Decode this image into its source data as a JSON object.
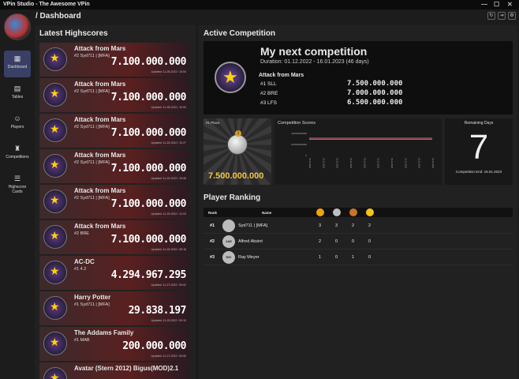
{
  "window": {
    "title": "VPin Studio - The Awesome VPin"
  },
  "header": {
    "breadcrumb": "/ Dashboard"
  },
  "nav": [
    {
      "label": "Dashboard",
      "icon": "grid-icon"
    },
    {
      "label": "Tables",
      "icon": "table-icon"
    },
    {
      "label": "Players",
      "icon": "user-icon"
    },
    {
      "label": "Competitions",
      "icon": "trophy-icon"
    },
    {
      "label": "Highscore Cards",
      "icon": "list-icon"
    }
  ],
  "highscores": {
    "title": "Latest Highscores",
    "items": [
      {
        "table": "Attack from Mars",
        "player": "#2  Syd711 | [MFA]",
        "score": "7.100.000.000",
        "updated": "Updated: 11-28-2022 / 10:54"
      },
      {
        "table": "Attack from Mars",
        "player": "#2  Syd711 | [MFA]",
        "score": "7.100.000.000",
        "updated": "Updated: 11-28-2022 / 10:53"
      },
      {
        "table": "Attack from Mars",
        "player": "#2  Syd711 | [MFA]",
        "score": "7.100.000.000",
        "updated": "Updated: 11-29-2022 / 10:27"
      },
      {
        "table": "Attack from Mars",
        "player": "#2  Syd711 | [MFA]",
        "score": "7.100.000.000",
        "updated": "Updated: 11-29-2022 / 10:08"
      },
      {
        "table": "Attack from Mars",
        "player": "#2  Syd711 | [MFA]",
        "score": "7.100.000.000",
        "updated": "Updated: 11-29-2022 / 12:03"
      },
      {
        "table": "Attack from Mars",
        "player": "#2  BRE",
        "score": "7.100.000.000",
        "updated": "Updated: 11-29-2022 / 08:18"
      },
      {
        "table": "AC-DC",
        "player": "#1  4.2",
        "score": "4.294.967.295",
        "updated": "Updated: 11-27-2022 / 09:02"
      },
      {
        "table": "Harry Potter",
        "player": "#1  Syd711 | [MFA]",
        "score": "29.838.197",
        "updated": "Updated: 11-29-2022 / 09:10"
      },
      {
        "table": "The Addams Family",
        "player": "#1  MAB",
        "score": "200.000.000",
        "updated": "Updated: 11-27-2022 / 09:06"
      },
      {
        "table": "Avatar (Stern 2012)  Bigus(MOD)2.1",
        "player": "",
        "score": "",
        "updated": ""
      }
    ]
  },
  "competition": {
    "section_title": "Active Competition",
    "name": "My next competition",
    "duration": "Duration: 01.12.2022  -  16.01.2023 (46 days)",
    "table": "Attack from Mars",
    "ranks": [
      {
        "pos": "#1",
        "player": "SLL",
        "score": "7.500.000.000"
      },
      {
        "pos": "#2",
        "player": "BRE",
        "score": "7.000.000.000"
      },
      {
        "pos": "#3",
        "player": "LFS",
        "score": "6.500.000.000"
      }
    ],
    "first_place_label": "#1 Place",
    "first_place_value": "7.500.000.000",
    "scores_label": "Competition Scores",
    "remaining_label": "Remaining Days",
    "remaining_value": "7",
    "end_label": "Competition End: 16.01.2023"
  },
  "chart_data": {
    "type": "line",
    "title": "Competition Scores",
    "yticks": [
      "110000000000",
      "100000000000",
      "0"
    ],
    "x": [
      "01.12.2022",
      "01.12.2022",
      "01.12.2022",
      "01.12.2022",
      "01.12.2022",
      "01.12.2022",
      "01.12.2022",
      "01.12.2022",
      "01.12.2022",
      "01.12.2022"
    ],
    "series": [
      {
        "values": [
          70,
          70,
          70,
          70,
          70,
          70,
          70,
          70,
          70,
          70
        ],
        "color": "#5b8ee6"
      },
      {
        "values": [
          75,
          75,
          75,
          75,
          75,
          75,
          75,
          75,
          75,
          75
        ],
        "color": "#e05555"
      }
    ]
  },
  "ranking": {
    "title": "Player Ranking",
    "headers": {
      "rank": "Rank",
      "name": "Name"
    },
    "medal_colors": [
      "#f2a20c",
      "#bdbdbd",
      "#c8742a",
      "#f5c518"
    ],
    "rows": [
      {
        "rank": "#1",
        "name": "Syd711 | [MFA]",
        "avatar": "",
        "counts": [
          "3",
          "3",
          "2",
          "2"
        ]
      },
      {
        "rank": "#2",
        "name": "Alfred Absint",
        "avatar": "AAB",
        "counts": [
          "2",
          "0",
          "0",
          "0"
        ]
      },
      {
        "rank": "#3",
        "name": "Ray Meyer",
        "avatar": "RAY",
        "counts": [
          "1",
          "0",
          "1",
          "0"
        ]
      }
    ]
  }
}
